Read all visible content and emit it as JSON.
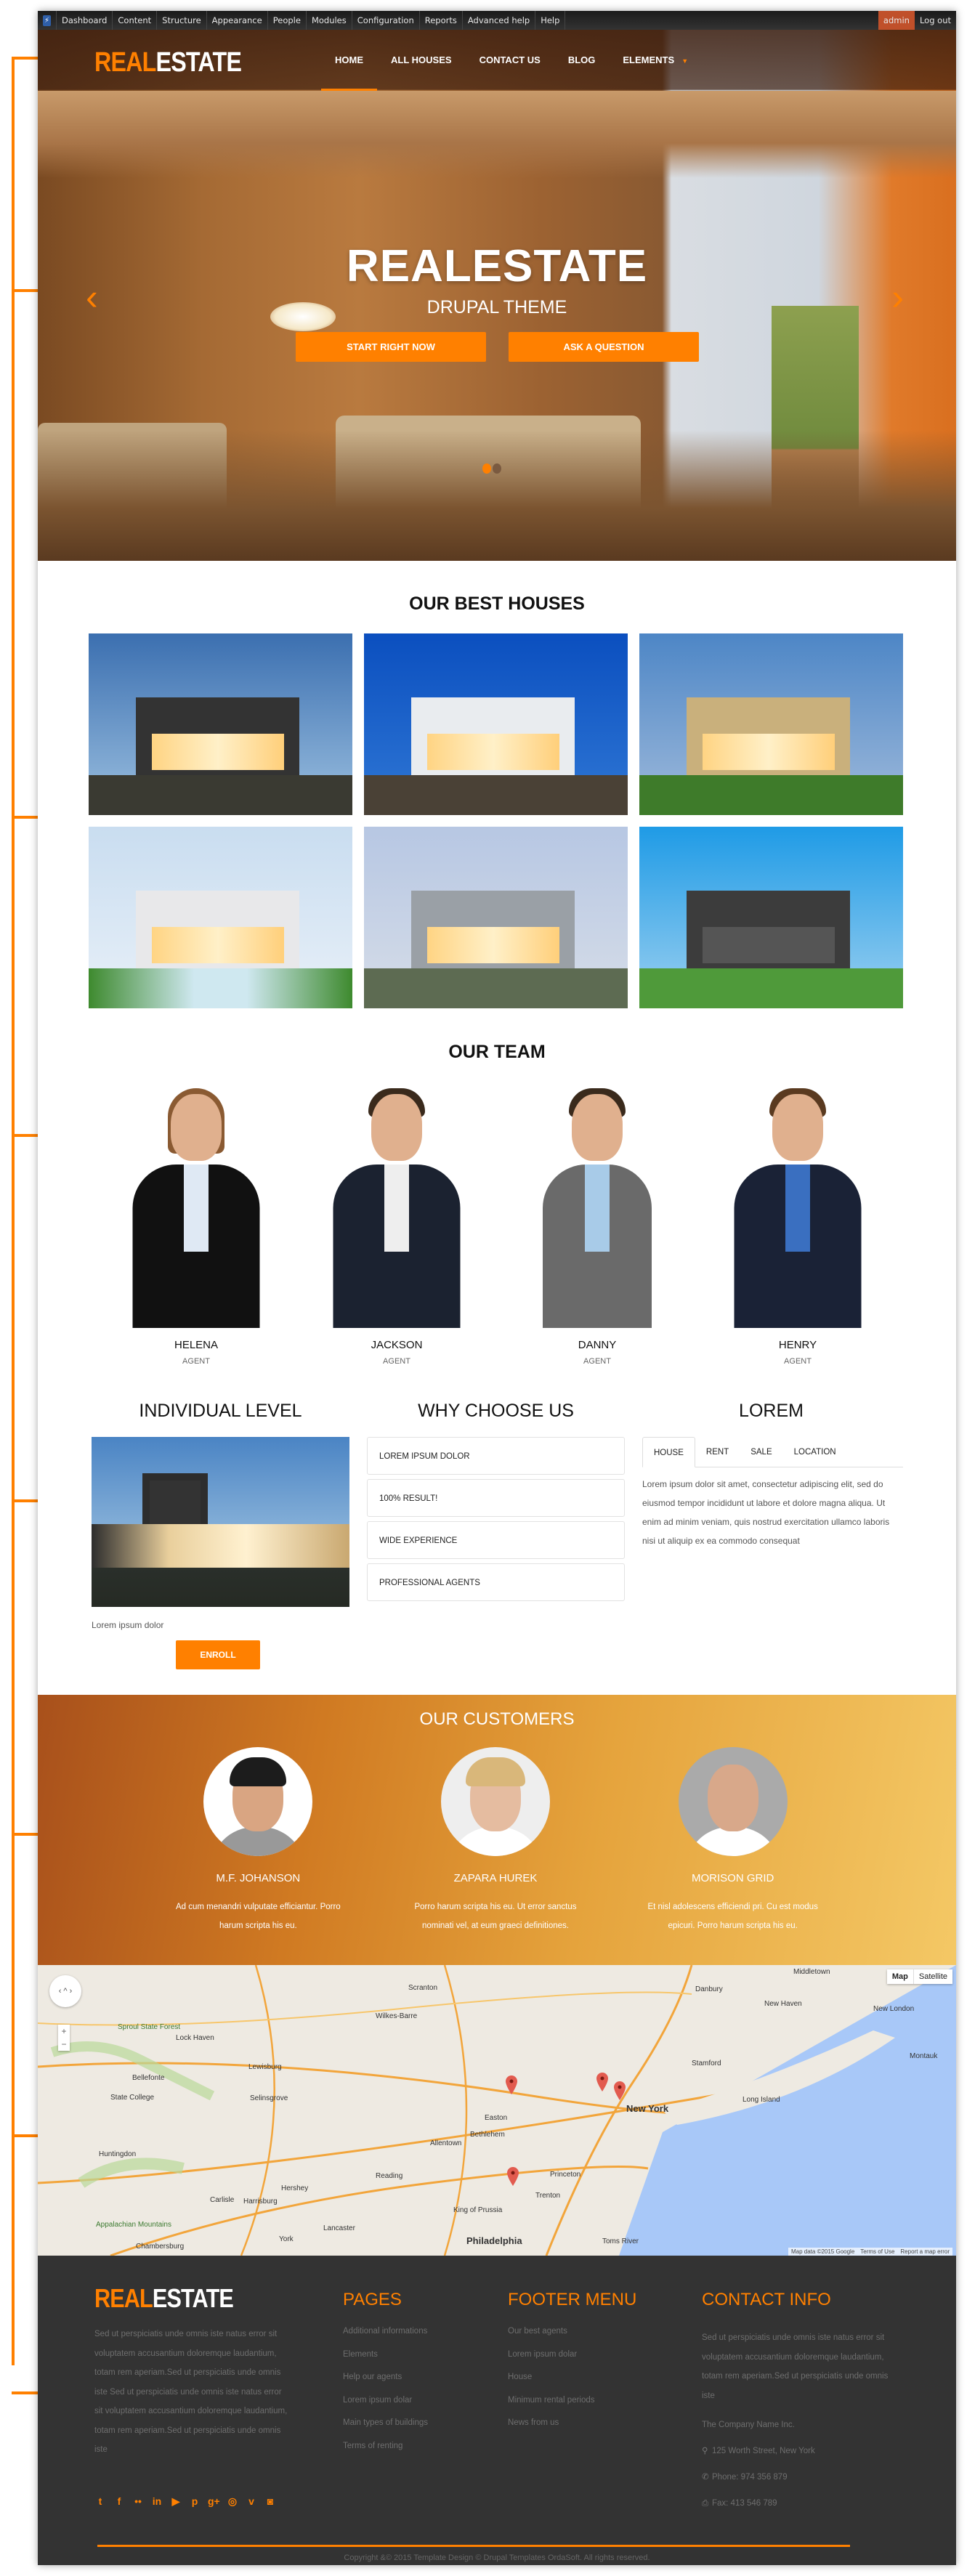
{
  "toolbar": {
    "items": [
      "Dashboard",
      "Content",
      "Structure",
      "Appearance",
      "People",
      "Modules",
      "Configuration",
      "Reports",
      "Advanced help",
      "Help"
    ],
    "user": "admin",
    "logout": "Log out"
  },
  "header": {
    "logo_accent": "REAL",
    "logo_rest": "ESTATE",
    "nav": [
      {
        "label": "HOME",
        "active": true
      },
      {
        "label": "ALL HOUSES"
      },
      {
        "label": "CONTACT US"
      },
      {
        "label": "BLOG"
      },
      {
        "label": "ELEMENTS",
        "has_dropdown": true
      }
    ]
  },
  "hero": {
    "title": "REALESTATE",
    "subtitle": "DRUPAL THEME",
    "primary_button": "START RIGHT NOW",
    "secondary_button": "ASK A QUESTION",
    "prev_icon": "‹",
    "next_icon": "›",
    "slides": 2,
    "active_slide": 1
  },
  "best_houses": {
    "title": "OUR BEST HOUSES",
    "items": [
      {
        "alt": "Modern house at dusk with glass facade"
      },
      {
        "alt": "White modern house under blue sky"
      },
      {
        "alt": "Beige two-storey house with balcony"
      },
      {
        "alt": "White house with pool"
      },
      {
        "alt": "Grey flat-roof house with garden"
      },
      {
        "alt": "Dark modern house with lawn"
      }
    ]
  },
  "team": {
    "title": "OUR TEAM",
    "members": [
      {
        "name": "HELENA",
        "role": "AGENT"
      },
      {
        "name": "JACKSON",
        "role": "AGENT"
      },
      {
        "name": "DANNY",
        "role": "AGENT"
      },
      {
        "name": "HENRY",
        "role": "AGENT"
      }
    ]
  },
  "individual": {
    "title": "INDIVIDUAL LEVEL",
    "caption": "Lorem ipsum dolor",
    "button": "ENROLL"
  },
  "why": {
    "title": "WHY CHOOSE US",
    "items": [
      "LOREM IPSUM DOLOR",
      "100% RESULT!",
      "WIDE EXPERIENCE",
      "PROFESSIONAL AGENTS"
    ]
  },
  "lorem": {
    "title": "LOREM",
    "tabs": [
      "HOUSE",
      "RENT",
      "SALE",
      "LOCATION"
    ],
    "active_tab": "HOUSE",
    "body": "Lorem ipsum dolor sit amet, consectetur adipiscing elit, sed do eiusmod tempor incididunt ut labore et dolore magna aliqua. Ut enim ad minim veniam, quis nostrud exercitation ullamco laboris nisi ut aliquip ex ea commodo consequat"
  },
  "customers": {
    "title": "OUR CUSTOMERS",
    "items": [
      {
        "name": "M.F. JOHANSON",
        "quote": "Ad cum menandri vulputate efficiantur. Porro harum scripta his eu."
      },
      {
        "name": "ZAPARA HUREK",
        "quote": "Porro harum scripta his eu. Ut error sanctus nominati vel, at eum graeci definitiones."
      },
      {
        "name": "MORISON GRID",
        "quote": "Et nisl adolescens efficiendi pri. Cu est modus epicuri. Porro harum scripta his eu."
      }
    ]
  },
  "map": {
    "type_map": "Map",
    "type_satellite": "Satellite",
    "zoom_in": "+",
    "zoom_out": "−",
    "credits": [
      "Map data ©2015 Google",
      "Terms of Use",
      "Report a map error"
    ],
    "labels": [
      "Middletown",
      "Scranton",
      "Danbury",
      "New Haven",
      "New London",
      "Wilkes-Barre",
      "Sproul State Forest",
      "Lock Haven",
      "Lewisburg",
      "Stamford",
      "Montauk",
      "Bellefonte",
      "State College",
      "Selinsgrove",
      "Long Island",
      "New York",
      "Easton",
      "Bethlehem",
      "Allentown",
      "Huntingdon",
      "Reading",
      "Princeton",
      "Hershey",
      "Trenton",
      "Carlisle",
      "Harrisburg",
      "King of Prussia",
      "Lancaster",
      "Appalachian Mountains",
      "Chambersburg",
      "York",
      "Philadelphia",
      "Toms River"
    ],
    "markers": 4
  },
  "footer": {
    "logo_accent": "REAL",
    "logo_rest": "ESTATE",
    "about": "Sed ut perspiciatis unde omnis iste natus error sit voluptatem accusantium doloremque laudantium, totam rem aperiam.Sed ut perspiciatis unde omnis iste Sed ut perspiciatis unde omnis iste natus error sit voluptatem accusantium doloremque laudantium, totam rem aperiam.Sed ut perspiciatis unde omnis iste",
    "social": [
      {
        "icon": "twitter-icon",
        "glyph": "t"
      },
      {
        "icon": "facebook-icon",
        "glyph": "f"
      },
      {
        "icon": "flickr-icon",
        "glyph": "••"
      },
      {
        "icon": "linkedin-icon",
        "glyph": "in"
      },
      {
        "icon": "youtube-icon",
        "glyph": "▶"
      },
      {
        "icon": "pinterest-icon",
        "glyph": "p"
      },
      {
        "icon": "google-plus-icon",
        "glyph": "g+"
      },
      {
        "icon": "dribbble-icon",
        "glyph": "◎"
      },
      {
        "icon": "vimeo-icon",
        "glyph": "v"
      },
      {
        "icon": "instagram-icon",
        "glyph": "◙"
      }
    ],
    "pages_title": "PAGES",
    "pages": [
      "Additional informations",
      "Elements",
      "Help our agents",
      "Lorem ipsum dolar",
      "Main types of buildings",
      "Terms of renting"
    ],
    "menu_title": "FOOTER MENU",
    "menu": [
      "Our best agents",
      "Lorem ipsum dolar",
      "House",
      "Minimum rental periods",
      "News from us"
    ],
    "contact_title": "CONTACT INFO",
    "contact_text": "Sed ut perspiciatis unde omnis iste natus error sit voluptatem accusantium doloremque laudantium, totam rem aperiam.Sed ut perspiciatis unde omnis iste",
    "company": "The Company Name Inc.",
    "address": "125 Worth Street, New York",
    "phone": "Phone: 974 356 879",
    "fax": "Fax: 413 546 789",
    "copyright": "Copyright &© 2015 Template Design © Drupal Templates OrdaSoft. All rights reserved."
  },
  "colors": {
    "accent": "#ff8000",
    "footer_bg": "#333333",
    "toolbar_admin": "#c0502a"
  }
}
